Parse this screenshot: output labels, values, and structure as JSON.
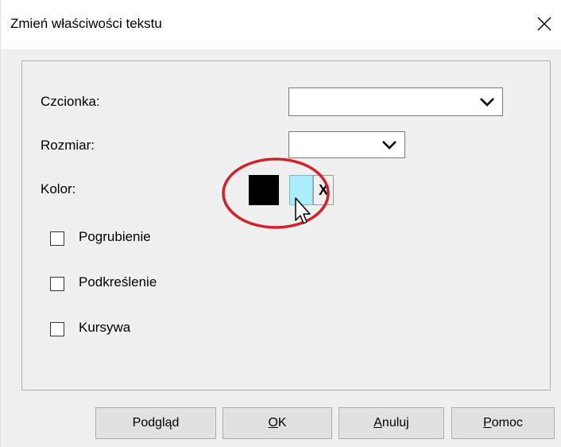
{
  "window": {
    "title": "Zmień właściwości tekstu"
  },
  "form": {
    "font_label": "Czcionka:",
    "font_value": "",
    "size_label": "Rozmiar:",
    "size_value": "",
    "color_label": "Kolor:",
    "color_current": "#000000",
    "color_picker_color": "#aaeefc",
    "clear_color_label": "X",
    "highlight_color": "#d4202a"
  },
  "checkboxes": [
    {
      "label": "Pogrubienie",
      "checked": false
    },
    {
      "label": "Podkreślenie",
      "checked": false
    },
    {
      "label": "Kursywa",
      "checked": false
    }
  ],
  "buttons": {
    "preview": "Podgląd",
    "ok_mnemonic": "O",
    "ok_rest": "K",
    "cancel_mnemonic": "A",
    "cancel_rest": "nuluj",
    "help_mnemonic": "P",
    "help_rest": "omoc"
  }
}
